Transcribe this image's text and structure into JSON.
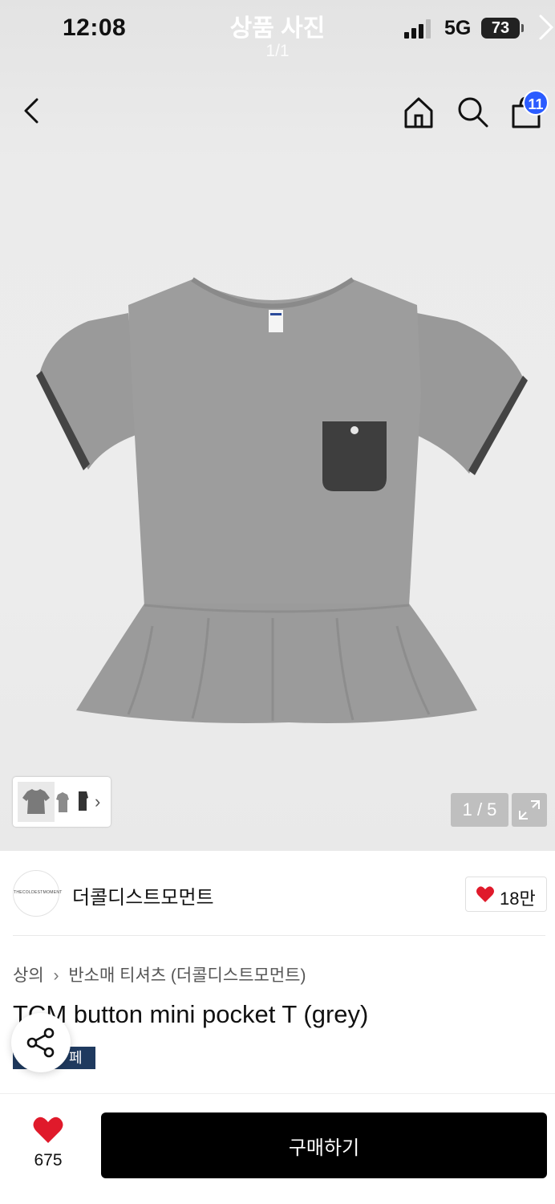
{
  "status_bar": {
    "time": "12:08",
    "network": "5G",
    "battery": "73"
  },
  "viewer": {
    "title": "상품 사진",
    "page": "1/1"
  },
  "nav": {
    "back_icon": "chevron-left-icon",
    "home_icon": "home-icon",
    "search_icon": "search-icon",
    "bag_icon": "shopping-bag-icon",
    "bag_badge": "11"
  },
  "gallery": {
    "counter": "1 / 5",
    "thumbs_more": "›",
    "expand_icon": "expand-icon"
  },
  "brand": {
    "logo_text": "THECOLDESTMOMENT",
    "name": "더콜디스트모먼트",
    "likes": "18만"
  },
  "product": {
    "breadcrumb": [
      "상의",
      "반소매 티셔츠 (더콜디스트모먼트)"
    ],
    "breadcrumb_separator": "›",
    "title": "TCM button mini pocket T (grey)",
    "tag": "페이"
  },
  "bottom": {
    "wish_count": "675",
    "buy_label": "구매하기"
  },
  "colors": {
    "badge": "#2b5cff",
    "heart": "#e01a2b",
    "buy_button": "#000000",
    "tag_chip": "#1f3a5f"
  }
}
